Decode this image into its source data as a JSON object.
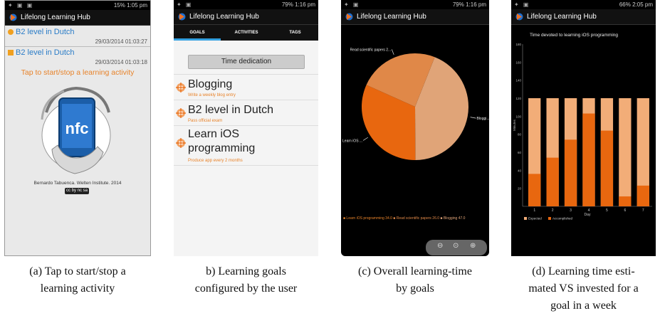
{
  "status": {
    "a": "15% 1:05 pm",
    "b": "79% 1:16 pm",
    "c": "79% 1:16 pm",
    "d": "66% 2:05 pm"
  },
  "app_title": "Lifelong Learning Hub",
  "panel_a": {
    "items": [
      {
        "label": "B2 level in Dutch",
        "timestamp": "29/03/2014 01:03:27"
      },
      {
        "label": "B2 level in Dutch",
        "timestamp": "29/03/2014 01:03:18"
      }
    ],
    "tap_text": "Tap to start/stop a learning activity",
    "nfc_label": "nfc",
    "credit": "Bernardo Tabuenca. Welten Institute. 2014",
    "license": "cc by nc sa",
    "caption_line1": "(a) Tap to start/stop a",
    "caption_line2": "learning activity"
  },
  "panel_b": {
    "tabs": [
      "GOALS",
      "ACTIVITIES",
      "TAGS"
    ],
    "button_label": "Time dedication",
    "goals": [
      {
        "title": "Blogging",
        "subtitle": "Write a weekly blog entry"
      },
      {
        "title": "B2 level in Dutch",
        "subtitle": "Pass official exam"
      },
      {
        "title_line1": "Learn iOS",
        "title_line2": "programming",
        "subtitle": "Produce app every 2 months"
      }
    ],
    "caption_line1": "b) Learning goals",
    "caption_line2": "configured by the user"
  },
  "panel_c": {
    "chart_data": {
      "type": "pie",
      "slices": [
        {
          "label": "Blogging",
          "value": 47.0,
          "color": "#e0a478"
        },
        {
          "label": "Learn iOS programming",
          "value": 34.0,
          "color": "#e8670f"
        },
        {
          "label": "Read scientific papers",
          "value": 26.0,
          "color": "#e08848"
        }
      ],
      "slice_labels": [
        "Read scientific papers 2...",
        "Bloggi...",
        "Learn iOS ..."
      ],
      "legend": [
        "Learn iOS programming 34.0",
        "Read scientific papers 26.0",
        "Blogging 47.0"
      ]
    },
    "zoom_icons": [
      "zoom-out",
      "reset",
      "zoom-in"
    ],
    "caption_line1": "(c) Overall learning-time",
    "caption_line2": "by goals"
  },
  "panel_d": {
    "chart_data": {
      "type": "bar",
      "title": "Time devoted to learning iOS programming",
      "categories": [
        "1",
        "2",
        "3",
        "4",
        "5",
        "6",
        "7"
      ],
      "ylim": [
        0,
        180
      ],
      "yticks": [
        "180",
        "160",
        "140",
        "120",
        "100",
        "80",
        "60",
        "40",
        "20"
      ],
      "xlabel": "Day",
      "ylabel": "Minutes",
      "series": [
        {
          "name": "Expected",
          "values": [
            120,
            120,
            120,
            120,
            120,
            120,
            120
          ],
          "color": "#f2ad78"
        },
        {
          "name": "Accomplished",
          "values": [
            36,
            54,
            74,
            103,
            84,
            11,
            23
          ],
          "color": "#e8670f"
        }
      ],
      "legend": [
        "Expected",
        "Accomplished"
      ]
    },
    "caption_line1": "(d) Learning time esti-",
    "caption_line2": "mated VS invested for a",
    "caption_line3": "goal in a week"
  }
}
